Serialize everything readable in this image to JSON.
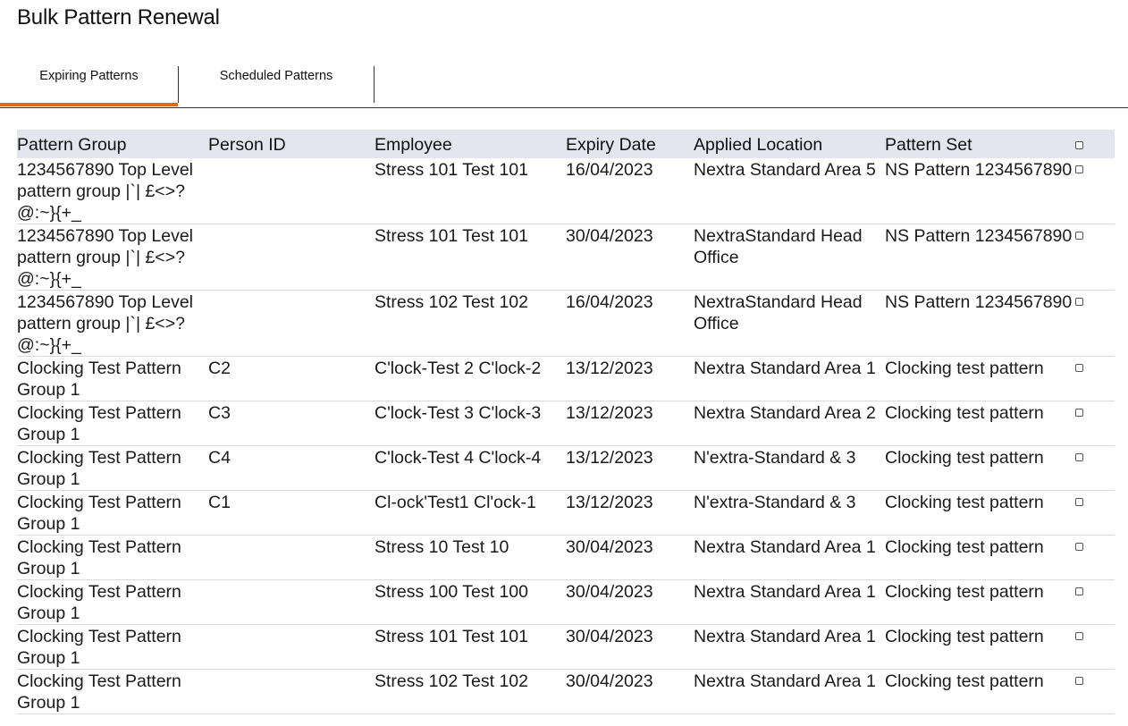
{
  "page": {
    "title": "Bulk Pattern Renewal"
  },
  "tabs": [
    {
      "label": "Expiring Patterns",
      "active": true
    },
    {
      "label": "Scheduled Patterns",
      "active": false
    }
  ],
  "colors": {
    "accent": "#e8650c",
    "header_bg": "#e3e6ef"
  },
  "table": {
    "columns": [
      "Pattern Group",
      "Person ID",
      "Employee",
      "Expiry Date",
      "Applied Location",
      "Pattern Set"
    ],
    "rows": [
      {
        "pattern_group": "1234567890 Top Level pattern group |`| £<>?@:~}{+_",
        "person_id": "",
        "employee": "Stress 101 Test 101",
        "expiry_date": "16/04/2023",
        "applied_location": "Nextra Standard Area 5",
        "pattern_set": "NS Pattern 1234567890"
      },
      {
        "pattern_group": "1234567890 Top Level pattern group |`| £<>?@:~}{+_",
        "person_id": "",
        "employee": "Stress 101 Test 101",
        "expiry_date": "30/04/2023",
        "applied_location": "NextraStandard Head Office",
        "pattern_set": "NS Pattern 1234567890"
      },
      {
        "pattern_group": "1234567890 Top Level pattern group |`| £<>?@:~}{+_",
        "person_id": "",
        "employee": "Stress 102 Test 102",
        "expiry_date": "16/04/2023",
        "applied_location": "NextraStandard Head Office",
        "pattern_set": "NS Pattern 1234567890"
      },
      {
        "pattern_group": "Clocking Test Pattern Group 1",
        "person_id": "C2",
        "employee": "C'lock-Test 2 C'lock-2",
        "expiry_date": "13/12/2023",
        "applied_location": "Nextra Standard Area 1",
        "pattern_set": "Clocking test pattern"
      },
      {
        "pattern_group": "Clocking Test Pattern Group 1",
        "person_id": "C3",
        "employee": "C'lock-Test 3 C'lock-3",
        "expiry_date": "13/12/2023",
        "applied_location": "Nextra Standard Area 2",
        "pattern_set": "Clocking test pattern"
      },
      {
        "pattern_group": "Clocking Test Pattern Group 1",
        "person_id": "C4",
        "employee": "C'lock-Test 4 C'lock-4",
        "expiry_date": "13/12/2023",
        "applied_location": "N'extra-Standard & 3",
        "pattern_set": "Clocking test pattern"
      },
      {
        "pattern_group": "Clocking Test Pattern Group 1",
        "person_id": "C1",
        "employee": "Cl-ock'Test1 Cl'ock-1",
        "expiry_date": "13/12/2023",
        "applied_location": "N'extra-Standard & 3",
        "pattern_set": "Clocking test pattern"
      },
      {
        "pattern_group": "Clocking Test Pattern Group 1",
        "person_id": "",
        "employee": "Stress 10 Test 10",
        "expiry_date": "30/04/2023",
        "applied_location": "Nextra Standard Area 1",
        "pattern_set": "Clocking test pattern"
      },
      {
        "pattern_group": "Clocking Test Pattern Group 1",
        "person_id": "",
        "employee": "Stress 100 Test 100",
        "expiry_date": "30/04/2023",
        "applied_location": "Nextra Standard Area 1",
        "pattern_set": "Clocking test pattern"
      },
      {
        "pattern_group": "Clocking Test Pattern Group 1",
        "person_id": "",
        "employee": "Stress 101 Test 101",
        "expiry_date": "30/04/2023",
        "applied_location": "Nextra Standard Area 1",
        "pattern_set": "Clocking test pattern"
      },
      {
        "pattern_group": "Clocking Test Pattern Group 1",
        "person_id": "",
        "employee": "Stress 102 Test 102",
        "expiry_date": "30/04/2023",
        "applied_location": "Nextra Standard Area 1",
        "pattern_set": "Clocking test pattern"
      }
    ]
  }
}
